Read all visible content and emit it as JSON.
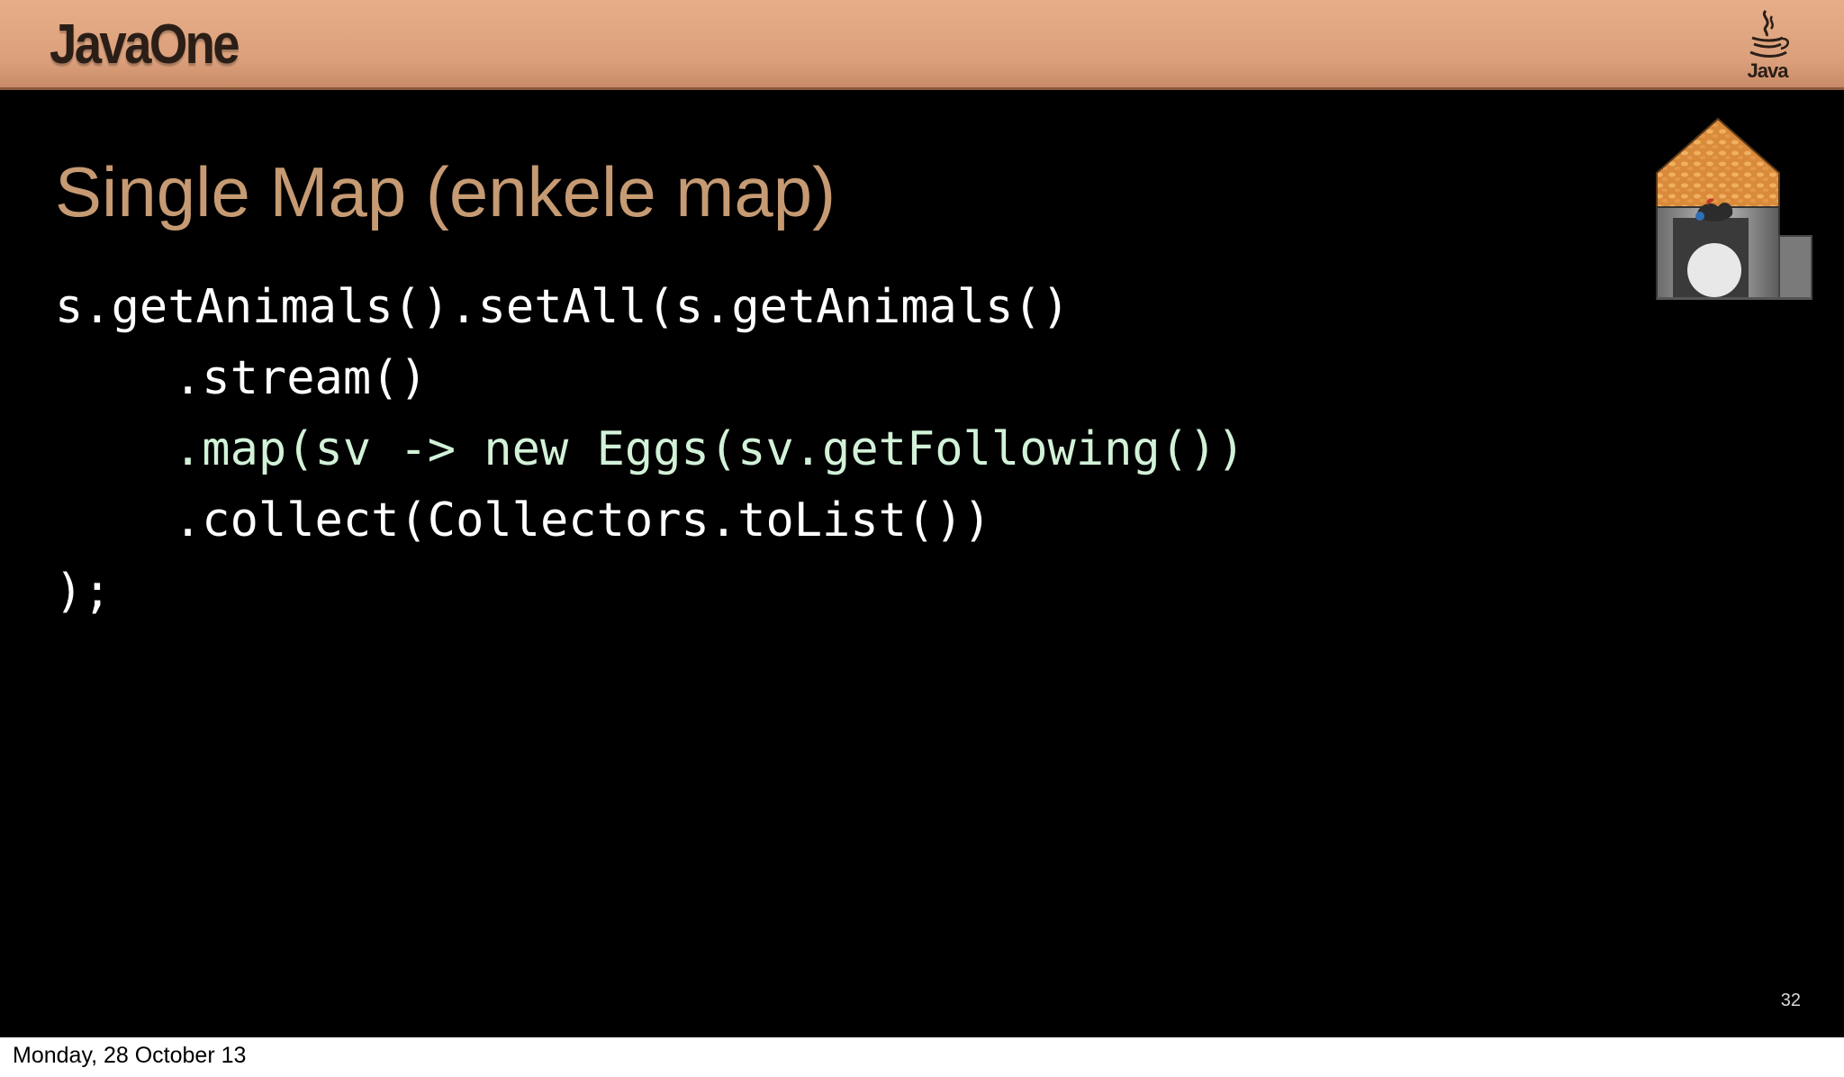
{
  "header": {
    "brand": "JavaOne",
    "java_logo_icon": "java-coffee-cup-icon",
    "java_logo_text": "Java"
  },
  "slide": {
    "title": "Single Map (enkele map)",
    "code_lines": [
      "s.getAnimals().setAll(s.getAnimals()",
      ".stream()",
      ".map(sv -> new Eggs(sv.getFollowing())",
      ".collect(Collectors.toList())",
      ");"
    ],
    "illustration_icon": "chicken-coop-icon",
    "slide_number": "32"
  },
  "footer": {
    "date": "Monday, 28 October 13"
  },
  "colors": {
    "header_bar": "#dba07b",
    "title": "#c69a72",
    "code_default": "#ffffff",
    "code_highlight": "#d2f2d8",
    "background": "#000000"
  }
}
